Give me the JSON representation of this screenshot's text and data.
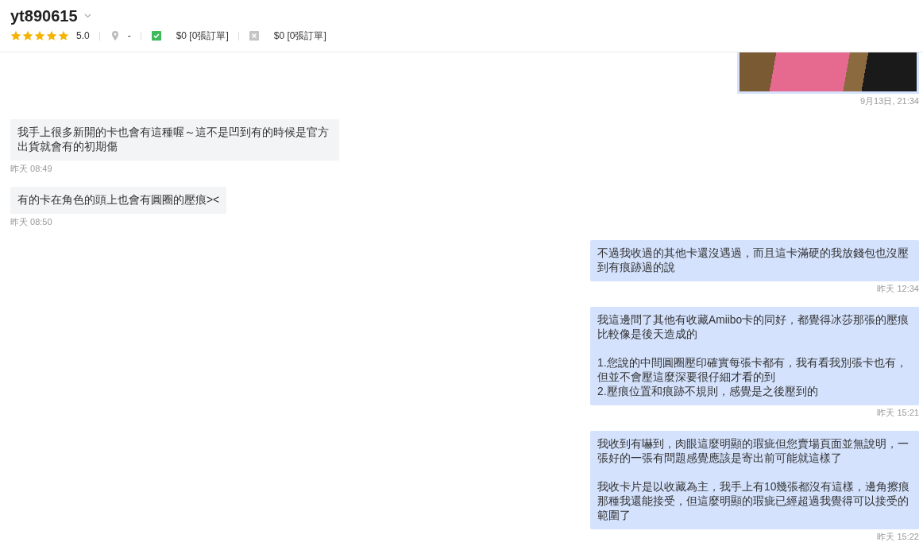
{
  "header": {
    "username": "yt890615",
    "stars": 5,
    "rating": "5.0",
    "location": "-",
    "stats": [
      {
        "kind": "completed",
        "text": "$0 [0張訂單]"
      },
      {
        "kind": "cancelled",
        "text": "$0 [0張訂單]"
      }
    ]
  },
  "messages": [
    {
      "kind": "image",
      "sent": true,
      "time": "9月13日, 21:34"
    },
    {
      "kind": "text",
      "sent": false,
      "paragraphs": [
        [
          "我手上很多新開的卡也會有這種喔～這不是凹到有的時候是官方出貨就會有的初期傷"
        ]
      ],
      "time": "昨天 08:49"
    },
    {
      "kind": "text",
      "sent": false,
      "paragraphs": [
        [
          "有的卡在角色的頭上也會有圓圈的壓痕><"
        ]
      ],
      "time": "昨天 08:50"
    },
    {
      "kind": "text",
      "sent": true,
      "paragraphs": [
        [
          "不過我收過的其他卡還沒遇過，而且這卡滿硬的我放錢包也沒壓到有痕跡過的說"
        ]
      ],
      "time": "昨天 12:34"
    },
    {
      "kind": "text",
      "sent": true,
      "paragraphs": [
        [
          "我這邊問了其他有收藏Amiibo卡的同好，都覺得冰莎那張的壓痕比較像是後天造成的"
        ],
        [
          "1.您說的中間圓圈壓印確實每張卡都有，我有看我別張卡也有，但並不會壓這麼深要很仔細才看的到",
          "2.壓痕位置和痕跡不規則，感覺是之後壓到的"
        ]
      ],
      "time": "昨天 15:21"
    },
    {
      "kind": "text",
      "sent": true,
      "paragraphs": [
        [
          "我收到有嚇到，肉眼這麼明顯的瑕疵但您賣場頁面並無說明，一張好的一張有問題感覺應該是寄出前可能就這樣了"
        ],
        [
          "我收卡片是以收藏為主，我手上有10幾張都沒有這樣，邊角擦痕那種我還能接受，但這麼明顯的瑕疵已經超過我覺得可以接受的範圍了"
        ]
      ],
      "time": "昨天 15:22"
    }
  ]
}
